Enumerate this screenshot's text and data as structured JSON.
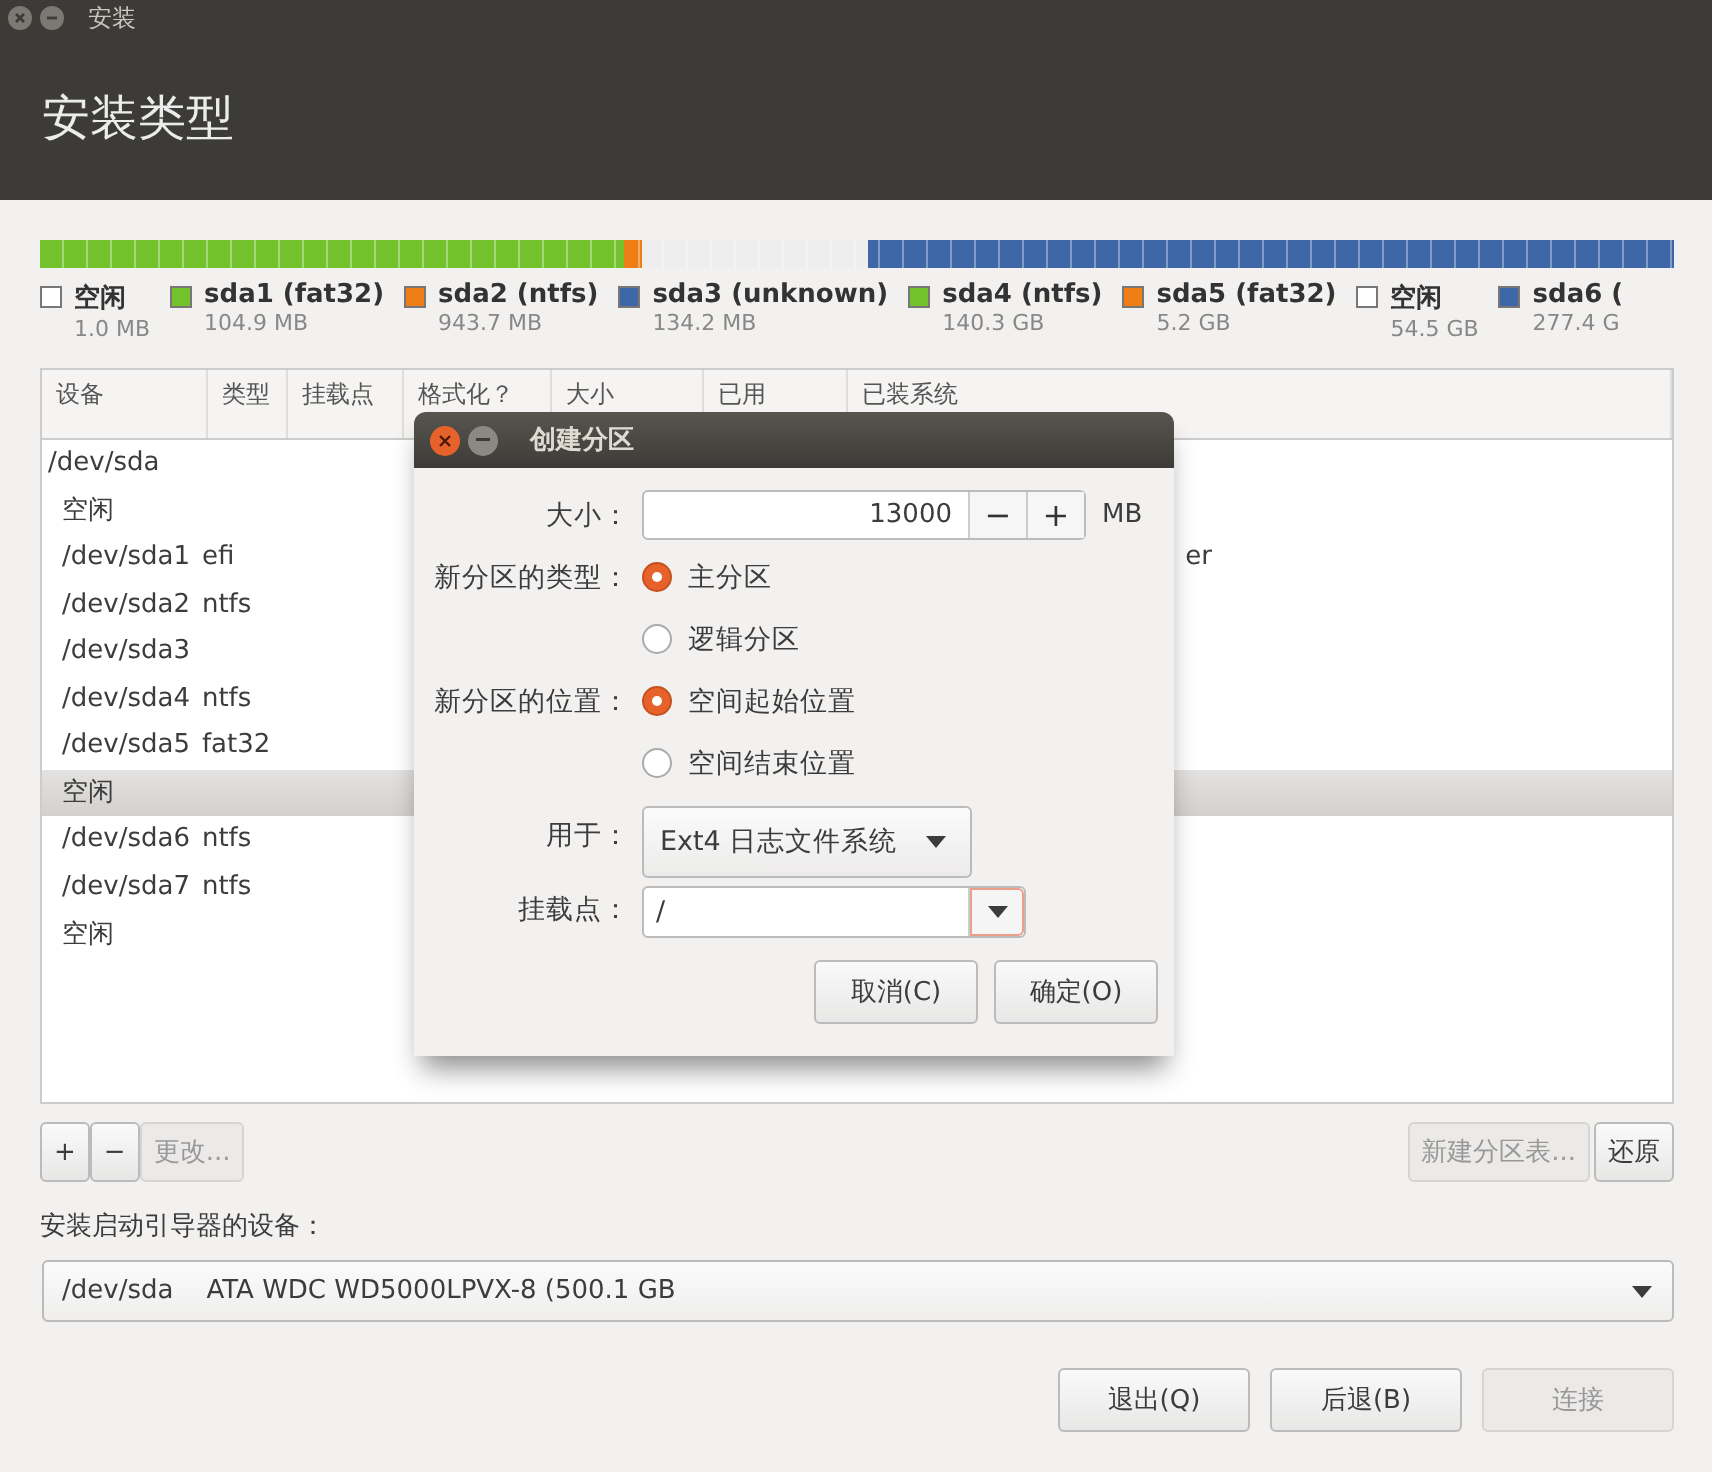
{
  "window": {
    "title": "安装"
  },
  "header": {
    "title": "安装类型"
  },
  "legend": [
    {
      "name": "空闲",
      "size": "1.0 MB",
      "color": "#ffffff"
    },
    {
      "name": "sda1 (fat32)",
      "size": "104.9 MB",
      "color": "#73c12b"
    },
    {
      "name": "sda2 (ntfs)",
      "size": "943.7 MB",
      "color": "#f07e16"
    },
    {
      "name": "sda3 (unknown)",
      "size": "134.2 MB",
      "color": "#3d67a6"
    },
    {
      "name": "sda4 (ntfs)",
      "size": "140.3 GB",
      "color": "#73c12b"
    },
    {
      "name": "sda5 (fat32)",
      "size": "5.2 GB",
      "color": "#f07e16"
    },
    {
      "name": "空闲",
      "size": "54.5 GB",
      "color": "#ffffff"
    },
    {
      "name": "sda6 (",
      "size": "277.4 G",
      "color": "#3d67a6"
    }
  ],
  "table": {
    "columns": [
      "设备",
      "类型",
      "挂载点",
      "格式化？",
      "大小",
      "已用",
      "已装系统"
    ],
    "rows": [
      {
        "device": "/dev/sda",
        "selected": false,
        "children": [
          {
            "device": "空闲",
            "selected": false
          },
          {
            "device": "/dev/sda1",
            "type": "efi",
            "installed": "er",
            "selected": false
          },
          {
            "device": "/dev/sda2",
            "type": "ntfs",
            "selected": false
          },
          {
            "device": "/dev/sda3",
            "selected": false
          },
          {
            "device": "/dev/sda4",
            "type": "ntfs",
            "selected": false
          },
          {
            "device": "/dev/sda5",
            "type": "fat32",
            "selected": false
          },
          {
            "device": "空闲",
            "selected": true
          },
          {
            "device": "/dev/sda6",
            "type": "ntfs",
            "selected": false
          },
          {
            "device": "/dev/sda7",
            "type": "ntfs",
            "selected": false
          },
          {
            "device": "空闲",
            "selected": false
          }
        ]
      }
    ]
  },
  "table_buttons": [
    {
      "label": "+",
      "disabled": false
    },
    {
      "label": "−",
      "disabled": false
    },
    {
      "label": "更改...",
      "disabled": true
    }
  ],
  "table_buttons_right": [
    {
      "label": "新建分区表...",
      "disabled": true
    },
    {
      "label": "还原",
      "disabled": false
    }
  ],
  "boot_device": {
    "label": "安装启动引导器的设备：",
    "value": "/dev/sda    ATA WDC WD5000LPVX-8 (500.1 GB"
  },
  "footer_buttons": [
    {
      "label": "退出(Q)",
      "disabled": false
    },
    {
      "label": "后退(B)",
      "disabled": false
    },
    {
      "label": "连接",
      "disabled": true
    }
  ],
  "dialog": {
    "title": "创建分区",
    "size": {
      "label": "大小：",
      "value": "13000",
      "minus": "−",
      "plus": "+",
      "unit": "MB"
    },
    "type": {
      "label": "新分区的类型：",
      "options": [
        {
          "label": "主分区",
          "selected": true
        },
        {
          "label": "逻辑分区",
          "selected": false
        }
      ]
    },
    "location": {
      "label": "新分区的位置：",
      "options": [
        {
          "label": "空间起始位置",
          "selected": true
        },
        {
          "label": "空间结束位置",
          "selected": false
        }
      ]
    },
    "use_as": {
      "label": "用于：",
      "value": "Ext4 日志文件系统"
    },
    "mount_point": {
      "label": "挂载点：",
      "value": "/"
    },
    "buttons": [
      "取消(C)",
      "确定(O)"
    ]
  }
}
